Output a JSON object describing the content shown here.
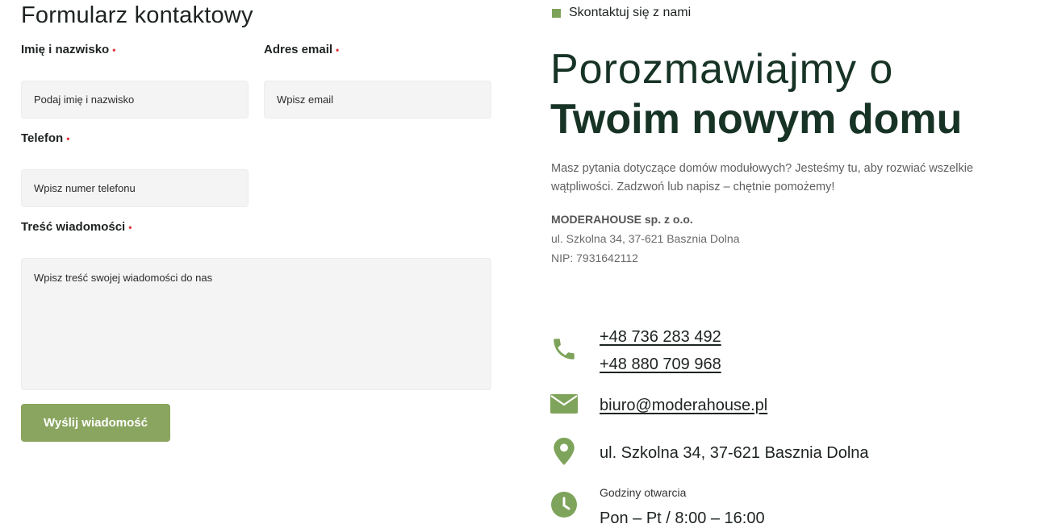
{
  "form": {
    "title": "Formularz kontaktowy",
    "required_mark": "•",
    "name": {
      "label": "Imię i nazwisko",
      "placeholder": "Podaj imię i nazwisko"
    },
    "email": {
      "label": "Adres email",
      "placeholder": "Wpisz email"
    },
    "phone": {
      "label": "Telefon",
      "placeholder": "Wpisz numer telefonu"
    },
    "message": {
      "label": "Treść wiadomości",
      "placeholder": "Wpisz treść swojej wiadomości do nas"
    },
    "submit_label": "Wyślij wiadomość"
  },
  "contact": {
    "kicker": "Skontaktuj się z nami",
    "heading_line1": "Porozmawiajmy o",
    "heading_line2": "Twoim nowym domu",
    "intro": "Masz pytania dotyczące domów modułowych? Jesteśmy tu, aby rozwiać wszelkie wątpliwości. Zadzwoń lub napisz – chętnie pomożemy!",
    "company": {
      "name": "MODERAHOUSE sp. z o.o.",
      "address": "ul. Szkolna 34, 37-621 Basznia Dolna",
      "nip": "NIP: 7931642112"
    },
    "phones": [
      "+48 736 283 492",
      "+48 880 709 968"
    ],
    "email": "biuro@moderahouse.pl",
    "address": "ul. Szkolna 34, 37-621 Basznia Dolna",
    "hours_label": "Godziny otwarcia",
    "hours_value": "Pon – Pt / 8:00 – 16:00",
    "icons": [
      "phone-icon",
      "envelope-icon",
      "map-pin-icon",
      "clock-icon"
    ],
    "accent_color": "#7ea35a"
  }
}
